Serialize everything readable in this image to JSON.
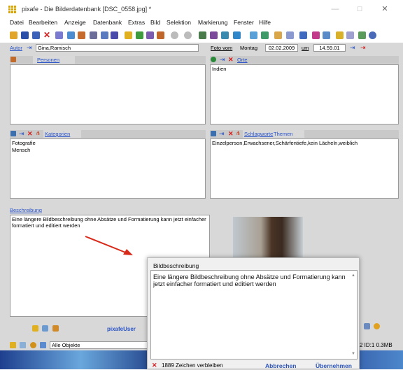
{
  "window": {
    "title": "pixafe - Die Bilderdatenbank  [DSC_0558.jpg] *",
    "minimize": "—",
    "maximize": "☐",
    "close": "✕"
  },
  "menu": [
    "Datei",
    "Bearbeiten",
    "Anzeige",
    "Datenbank",
    "Extras",
    "Bild",
    "Selektion",
    "Markierung",
    "Fenster",
    "Hilfe"
  ],
  "author": {
    "label": "Autor",
    "value": "Gina,Ramisch"
  },
  "photo_date": {
    "label": "Foto vom",
    "weekday": "Montag",
    "date": "02.02.2009",
    "at_label": "um",
    "time": "14.59.01"
  },
  "persons": {
    "label": "Personen",
    "content": ""
  },
  "places": {
    "label": "Orte",
    "content": "Indien"
  },
  "categories": {
    "label": "Kategorien",
    "items": [
      "Fotografie",
      "Mensch"
    ]
  },
  "keywords": {
    "label": "Schlagworte",
    "label_extra": "Themen",
    "content": "Einzelperson,Erwachsener,Schärfentiefe,kein Lächeln,weiblich"
  },
  "description": {
    "label": "Beschreibung",
    "content": "Eine längere Bildbeschreibung ohne Absätze und Formatierung kann jetzt einfacher formatiert und editiert werden"
  },
  "user_label": "pixafeUser",
  "status": {
    "filter": "Alle Objekte",
    "info": "2 ID:1 0.3MB"
  },
  "dialog": {
    "title": "Bildbeschreibung",
    "text": "Eine längere Bildbeschreibung ohne Absätze und Formatierung kann jetzt einfacher formatiert und editiert werden",
    "chars_remaining": "1889 Zeichen verbleiben",
    "cancel": "Abbrechen",
    "apply": "Übernehmen"
  },
  "colors": {
    "panel_bg": "#d8d8d8",
    "link": "#2b55c9",
    "delete": "#d21b1b",
    "accent": "#d9a400"
  }
}
